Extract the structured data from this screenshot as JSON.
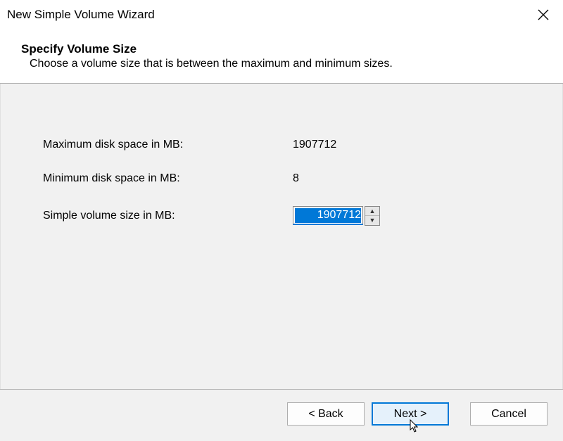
{
  "window": {
    "title": "New Simple Volume Wizard"
  },
  "header": {
    "title": "Specify Volume Size",
    "subtitle": "Choose a volume size that is between the maximum and minimum sizes."
  },
  "form": {
    "max_label": "Maximum disk space in MB:",
    "max_value": "1907712",
    "min_label": "Minimum disk space in MB:",
    "min_value": "8",
    "size_label": "Simple volume size in MB:",
    "size_value": "1907712"
  },
  "buttons": {
    "back": "< Back",
    "next": "Next >",
    "cancel": "Cancel"
  }
}
